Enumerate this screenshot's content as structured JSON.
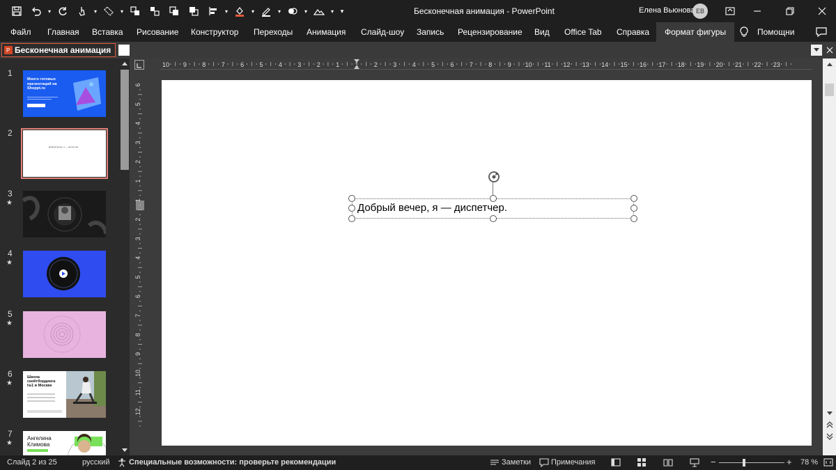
{
  "window": {
    "title": "Бесконечная анимация  -  PowerPoint",
    "user_name": "Елена Вьюнова",
    "user_initials": "ЕВ"
  },
  "ribbon": {
    "tabs": [
      {
        "label": "Файл"
      },
      {
        "label": "Главная"
      },
      {
        "label": "Вставка"
      },
      {
        "label": "Рисование"
      },
      {
        "label": "Конструктор"
      },
      {
        "label": "Переходы"
      },
      {
        "label": "Анимация"
      },
      {
        "label": "Слайд-шоу"
      },
      {
        "label": "Запись"
      },
      {
        "label": "Рецензирование"
      },
      {
        "label": "Вид"
      },
      {
        "label": "Office Tab"
      },
      {
        "label": "Справка"
      },
      {
        "label": "Формат фигуры"
      }
    ],
    "active_tab": "Формат фигуры",
    "help_label": "Помощни"
  },
  "doc_tab": {
    "label": "Бесконечная анимация"
  },
  "thumbnails": [
    {
      "number": "1",
      "starred": false,
      "title": "Много готовых презентаций на Shoppt.ru",
      "bg": "#1a5cf0"
    },
    {
      "number": "2",
      "starred": false,
      "title": "Добрый вечер, я — диспетчер.",
      "bg": "#ffffff"
    },
    {
      "number": "3",
      "starred": true,
      "title": "",
      "bg": "#1a1a1a"
    },
    {
      "number": "4",
      "starred": true,
      "title": "",
      "bg": "#2f4cf0"
    },
    {
      "number": "5",
      "starred": true,
      "title": "",
      "bg": "#e9b3e0"
    },
    {
      "number": "6",
      "starred": true,
      "title": "Школа скейтбординга №1 в Москве",
      "bg": "#ffffff"
    },
    {
      "number": "7",
      "starred": true,
      "title": "Ангелина Климова",
      "bg": "#ffffff"
    }
  ],
  "star_glyph": "★",
  "slide": {
    "text": "Добрый вечер, я — диспетчер."
  },
  "ruler": {
    "h_labels": [
      "10",
      "9",
      "8",
      "7",
      "6",
      "5",
      "4",
      "3",
      "2",
      "1",
      "1",
      "2",
      "3",
      "4",
      "5",
      "6",
      "7",
      "8",
      "9",
      "10",
      "11",
      "12",
      "13",
      "14",
      "15",
      "16",
      "17",
      "18",
      "19",
      "20",
      "21",
      "22",
      "23"
    ],
    "v_labels": [
      "6",
      "5",
      "4",
      "3",
      "2",
      "1",
      "1",
      "2",
      "3",
      "4",
      "5",
      "6",
      "7",
      "8",
      "9",
      "10",
      "11",
      "12"
    ]
  },
  "status": {
    "slide_info": "Слайд 2 из 25",
    "language": "русский",
    "accessibility": "Специальные возможности: проверьте рекомендации",
    "notes": "Заметки",
    "comments": "Примечания",
    "zoom": "78 %",
    "zoom_minus": "−",
    "zoom_plus": "+"
  },
  "colors": {
    "titlebar": "#1f1f1f",
    "accent": "#e05a3a",
    "canvas": "#3c3c3c"
  }
}
